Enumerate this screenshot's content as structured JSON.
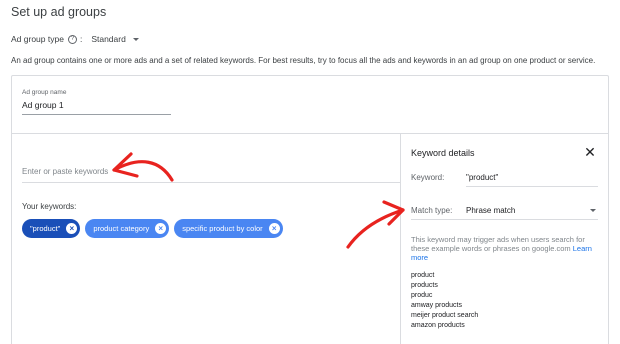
{
  "page_title": "Set up ad groups",
  "ad_group_type": {
    "label": "Ad group type",
    "help_symbol": "?",
    "colon": ":",
    "value": "Standard"
  },
  "description": "An ad group contains one or more ads and a set of related keywords. For best results, try to focus all the ads and keywords in an ad group on one product or service.",
  "ad_group_name": {
    "label": "Ad group name",
    "value": "Ad group 1"
  },
  "keywords": {
    "placeholder": "Enter or paste keywords",
    "your_keywords_label": "Your keywords:",
    "chips": [
      {
        "label": "\"product\"",
        "active": true
      },
      {
        "label": "product category",
        "active": false
      },
      {
        "label": "specific product by color",
        "active": false
      }
    ],
    "chip_remove_symbol": "×"
  },
  "keyword_details": {
    "title": "Keyword details",
    "close_symbol": "✕",
    "keyword_label": "Keyword:",
    "keyword_value": "\"product\"",
    "match_type_label": "Match type:",
    "match_type_value": "Phrase match",
    "hint_text": "This keyword may trigger ads when users search for these example words or phrases on google.com",
    "learn_more": "Learn more",
    "examples": [
      "product",
      "products",
      "produc",
      "amway products",
      "meijer product search",
      "amazon products"
    ]
  },
  "colors": {
    "accent": "#1a73e8",
    "chip_active": "#1a4fb8",
    "chip": "#4a86f2",
    "annotation_arrow": "#e8231f"
  },
  "icons": [
    "help-icon",
    "dropdown-caret-icon",
    "close-icon",
    "remove-chip-icon",
    "red-arrow-annotation"
  ]
}
